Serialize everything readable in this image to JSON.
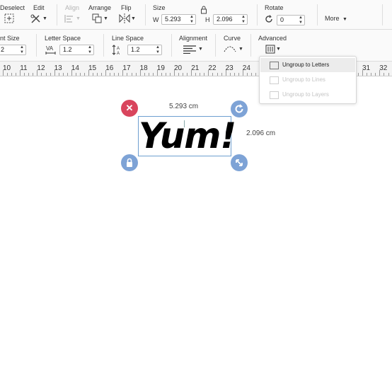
{
  "toolbar_top": {
    "deselect": "Deselect",
    "edit": "Edit",
    "align": "Align",
    "arrange": "Arrange",
    "flip": "Flip",
    "size": {
      "label": "Size",
      "w_label": "W",
      "w_value": "5.293",
      "h_label": "H",
      "h_value": "2.096"
    },
    "rotate": {
      "label": "Rotate",
      "value": "0"
    },
    "more": "More"
  },
  "toolbar_text": {
    "font_size": {
      "label": "nt Size",
      "value": "2"
    },
    "letter_space": {
      "label": "Letter Space",
      "value": "1.2"
    },
    "line_space": {
      "label": "Line Space",
      "value": "1.2"
    },
    "alignment": "Alignment",
    "curve": "Curve",
    "advanced": "Advanced"
  },
  "ruler": {
    "numbers": [
      "10",
      "11",
      "12",
      "13",
      "14",
      "15",
      "16",
      "17",
      "18",
      "19",
      "20",
      "21",
      "22",
      "23",
      "24",
      "31",
      "32"
    ]
  },
  "advanced_menu": {
    "items": [
      {
        "label": "Ungroup to Letters",
        "enabled": true
      },
      {
        "label": "Ungroup to Lines",
        "enabled": false
      },
      {
        "label": "Ungroup to Layers",
        "enabled": false
      }
    ]
  },
  "canvas": {
    "text": "Yum!",
    "width_readout": "5.293 cm",
    "height_readout": "2.096 cm",
    "colors": {
      "delete": "#d9455d",
      "handle": "#7ea3d6",
      "selection": "#6e9fd0"
    }
  }
}
